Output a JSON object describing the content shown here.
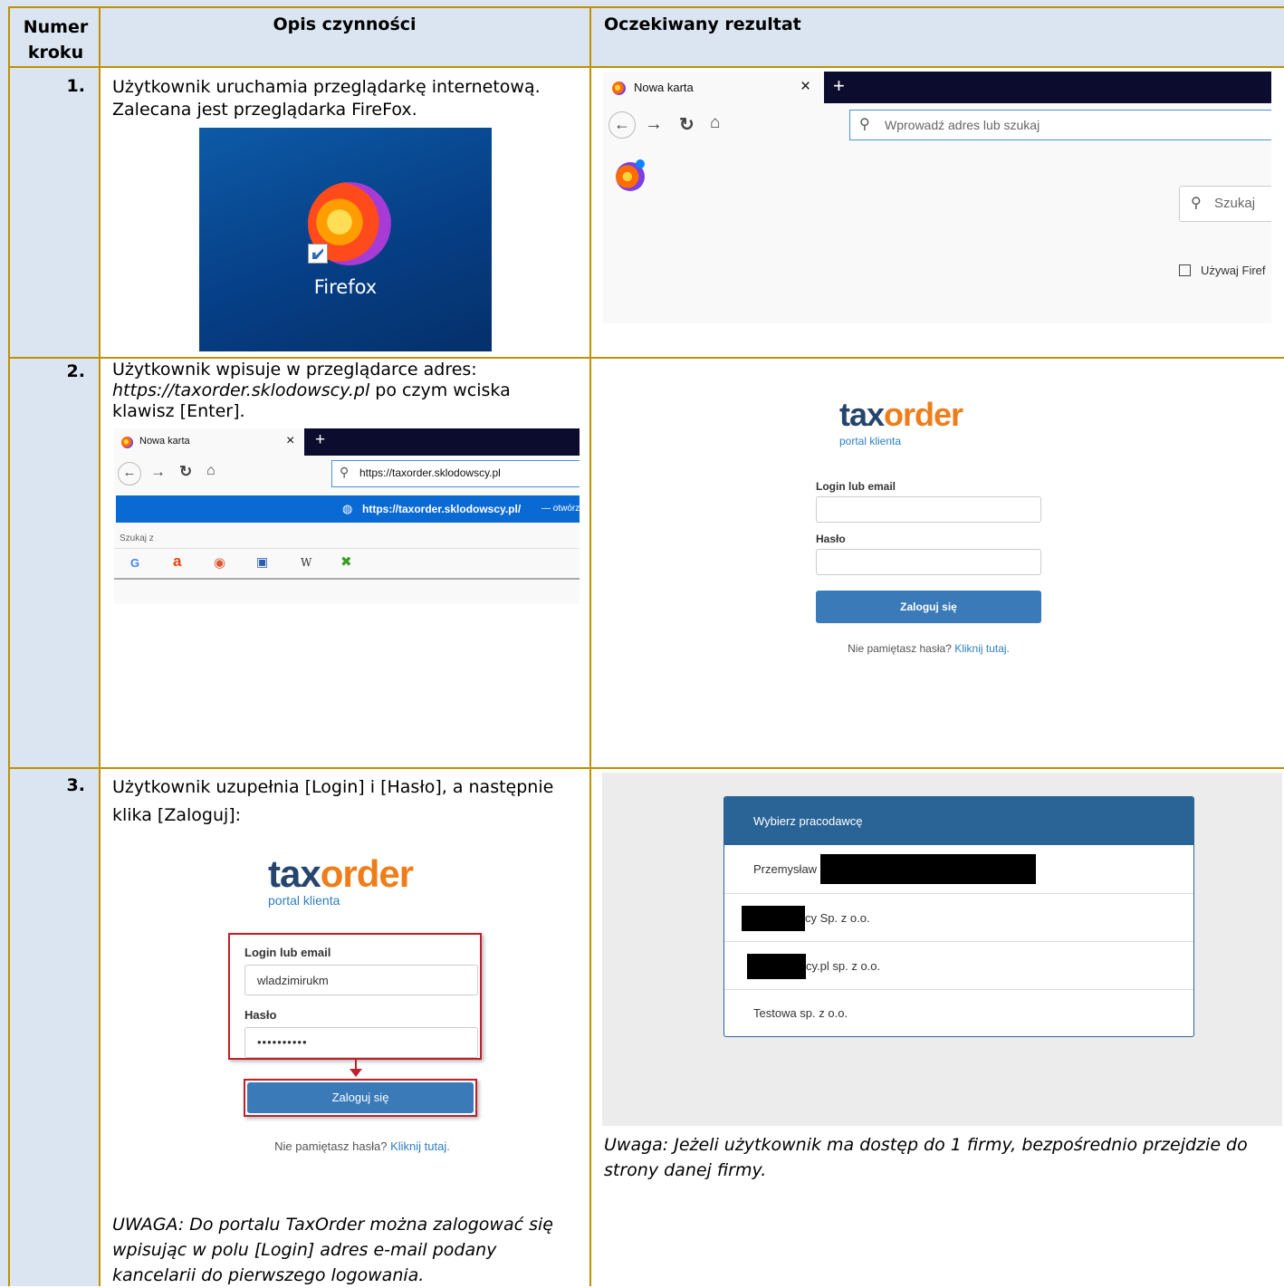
{
  "header": {
    "col1": "Numer kroku",
    "col1_line1": "Numer",
    "col1_line2": "kroku",
    "col2": "Opis czynności",
    "col3": "Oczekiwany rezultat"
  },
  "rows": [
    {
      "number": "1.",
      "description_line1": "Użytkownik uruchamia przeglądarkę internetową.",
      "description_line2": "Zalecana jest przeglądarka FireFox.",
      "desktop_icon_label": "Firefox",
      "result": {
        "tab_label": "Nowa karta",
        "tab_close": "×",
        "new_tab": "+",
        "url_placeholder": "Wprowadź adres lub szukaj",
        "search_placeholder": "Szukaj",
        "use_firefox_label": "Używaj Firef"
      }
    },
    {
      "number": "2.",
      "description_line1": "Użytkownik wpisuje w przeglądarce adres:",
      "url_italic": "https://taxorder.sklodowscy.pl",
      "description_line2_rest": " po czym wciska",
      "description_line3": "klawisz [Enter].",
      "browser": {
        "tab_label": "Nowa karta",
        "tab_close": "×",
        "new_tab": "+",
        "url_value": "https://taxorder.sklodowscy.pl",
        "suggestion": "https://taxorder.sklodowscy.pl/",
        "suggestion_suffix": "— otwórz",
        "search_with": "Szukaj z",
        "engines": [
          "G",
          "a",
          "◉",
          "▣",
          "W",
          "✖"
        ]
      },
      "result": {
        "logo_main_1": "tax",
        "logo_main_2": "order",
        "logo_sub": "portal klienta",
        "login_label": "Login lub email",
        "password_label": "Hasło",
        "login_button": "Zaloguj się",
        "forgot_text": "Nie pamiętasz hasła?",
        "forgot_link": "Kliknij tutaj."
      }
    },
    {
      "number": "3.",
      "description_line1": "Użytkownik uzupełnia [Login] i [Hasło], a następnie",
      "description_line2": "klika [Zaloguj]:",
      "form": {
        "logo_main_1": "tax",
        "logo_main_2": "order",
        "logo_sub": "portal klienta",
        "login_label": "Login lub email",
        "login_value": "wladzimirukm",
        "password_label": "Hasło",
        "password_value": "••••••••••",
        "login_button": "Zaloguj się",
        "forgot_text": "Nie pamiętasz hasła?",
        "forgot_link": "Kliknij tutaj."
      },
      "note_line1": "UWAGA: Do portalu TaxOrder można zalogować się",
      "note_line2": "wpisując w polu [Login] adres e-mail podany",
      "note_line3": "kancelarii do pierwszego logowania.",
      "result": {
        "panel_title": "Wybierz pracodawcę",
        "items": [
          "Przemysław",
          "cy Sp. z o.o.",
          "cy.pl sp. z o.o.",
          "Testowa sp. z o.o."
        ],
        "note_line1": "Uwaga: Jeżeli użytkownik ma dostęp do 1 firmy, bezpośrednio przejdzie do",
        "note_line2": "strony danej firmy."
      }
    }
  ],
  "colors": {
    "header_bg": "#dbe5f1",
    "number_col_bg": "#dbe5f1",
    "border": "#c09000",
    "brand_blue": "#2a6496",
    "brand_orange": "#ef7d1a"
  }
}
